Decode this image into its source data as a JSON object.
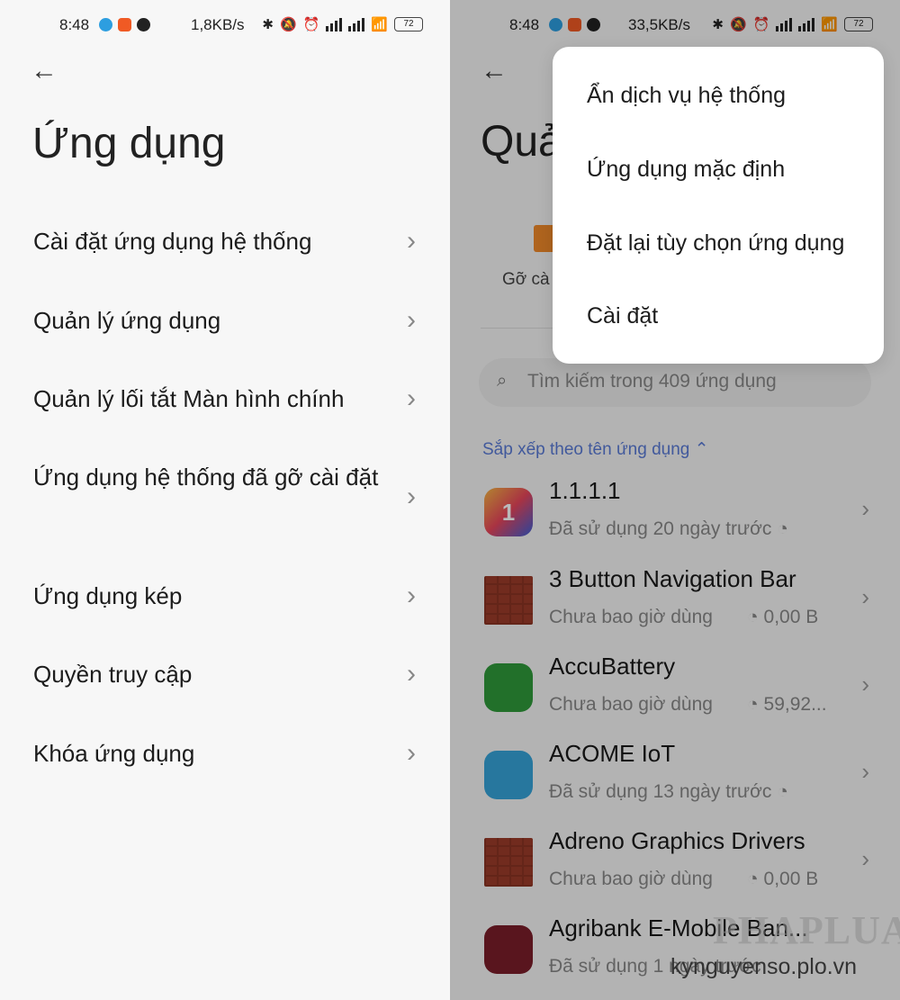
{
  "left": {
    "status": {
      "time": "8:48",
      "speed": "1,8KB/s",
      "battery": "72"
    },
    "title": "Ứng dụng",
    "items": [
      {
        "label": "Cài đặt ứng dụng hệ thống"
      },
      {
        "label": "Quản lý ứng dụng"
      },
      {
        "label": "Quản lý lối tắt Màn hình chính"
      },
      {
        "label": "Ứng dụng hệ thống đã gỡ cài đặt"
      },
      {
        "label": "Ứng dụng kép"
      },
      {
        "label": "Quyền truy cập"
      },
      {
        "label": "Khóa ứng dụng"
      }
    ]
  },
  "right": {
    "status": {
      "time": "8:48",
      "speed": "33,5KB/s",
      "battery": "72"
    },
    "title_partial": "Quả",
    "uninstall_label": "Gỡ cà",
    "search_placeholder": "Tìm kiếm trong 409 ứng dụng",
    "sort_label": "Sắp xếp theo tên ứng dụng ⌃",
    "apps": [
      {
        "name": "1.1.1.1",
        "meta": "Đã sử dụng 20 ngày trước",
        "size": "",
        "icon": "1111-icon"
      },
      {
        "name": "3 Button Navigation Bar",
        "meta": "Chưa bao giờ dùng",
        "size": "0,00 B",
        "icon": "android-icon"
      },
      {
        "name": "AccuBattery",
        "meta": "Chưa bao giờ dùng",
        "size": "59,92...",
        "icon": "accubattery-icon"
      },
      {
        "name": "ACOME IoT",
        "meta": "Đã sử dụng 13 ngày trước",
        "size": "",
        "icon": "acome-icon"
      },
      {
        "name": "Adreno Graphics Drivers",
        "meta": "Chưa bao giờ dùng",
        "size": "0,00 B",
        "icon": "android-icon"
      },
      {
        "name": "Agribank E-Mobile Ban...",
        "meta": "Đã sử dụng 1 ngày trước",
        "size": "",
        "icon": "agribank-icon"
      }
    ],
    "popup_menu": [
      {
        "label": "Ẩn dịch vụ hệ thống"
      },
      {
        "label": "Ứng dụng mặc định"
      },
      {
        "label": "Đặt lại tùy chọn ứng dụng"
      },
      {
        "label": "Cài đặt"
      }
    ]
  },
  "watermark": {
    "title": "PHAPLUAT",
    "url": "kynguyenso.plo.vn"
  }
}
